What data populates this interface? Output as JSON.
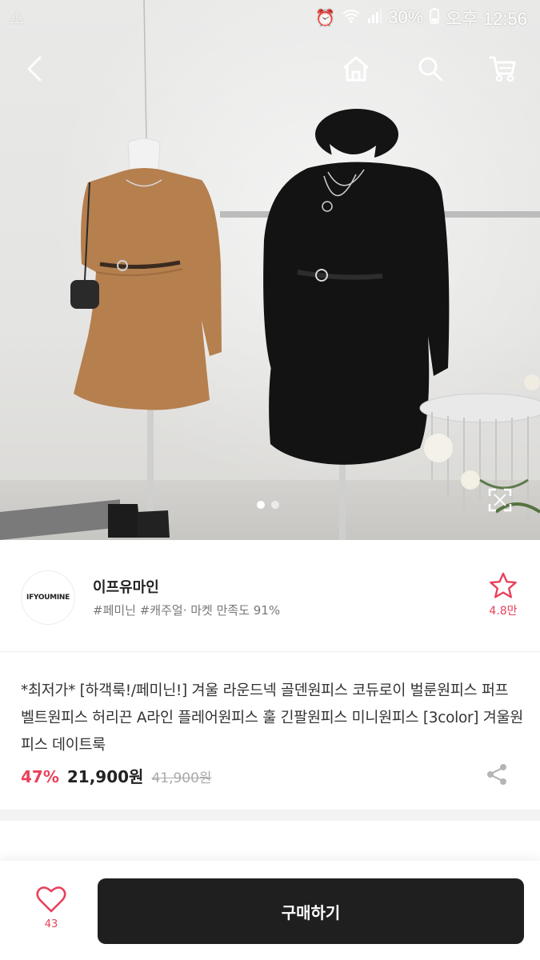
{
  "status_bar": {
    "alert_icon": "warning-icon",
    "battery": "30%",
    "clock": "오후 12:56"
  },
  "nav": {
    "back_icon": "chevron-left-icon",
    "home_icon": "home-icon",
    "search_icon": "search-icon",
    "cart_icon": "cart-icon"
  },
  "gallery": {
    "page_count": 2,
    "current_page": 1
  },
  "shop": {
    "logo_text": "IFYOUMINE",
    "name": "이프유마인",
    "tags": "#페미닌 #캐주얼· 마켓 만족도 91%",
    "favorite_count": "4.8만"
  },
  "product": {
    "title": "*최저가* [하객룩!/페미닌!] 겨울 라운드넥 골덴원피스 코듀로이 벌룬원피스 퍼프 벨트원피스 허리끈 A라인 플레어원피스 훌 긴팔원피스 미니원피스 [3color] 겨울원피스 데이트룩",
    "discount": "47%",
    "price": "21,900원",
    "original_price": "41,900원"
  },
  "bottom_bar": {
    "like_count": "43",
    "buy_label": "구매하기"
  },
  "colors": {
    "accent": "#e8415b",
    "buy_button": "#1f1f1f"
  }
}
